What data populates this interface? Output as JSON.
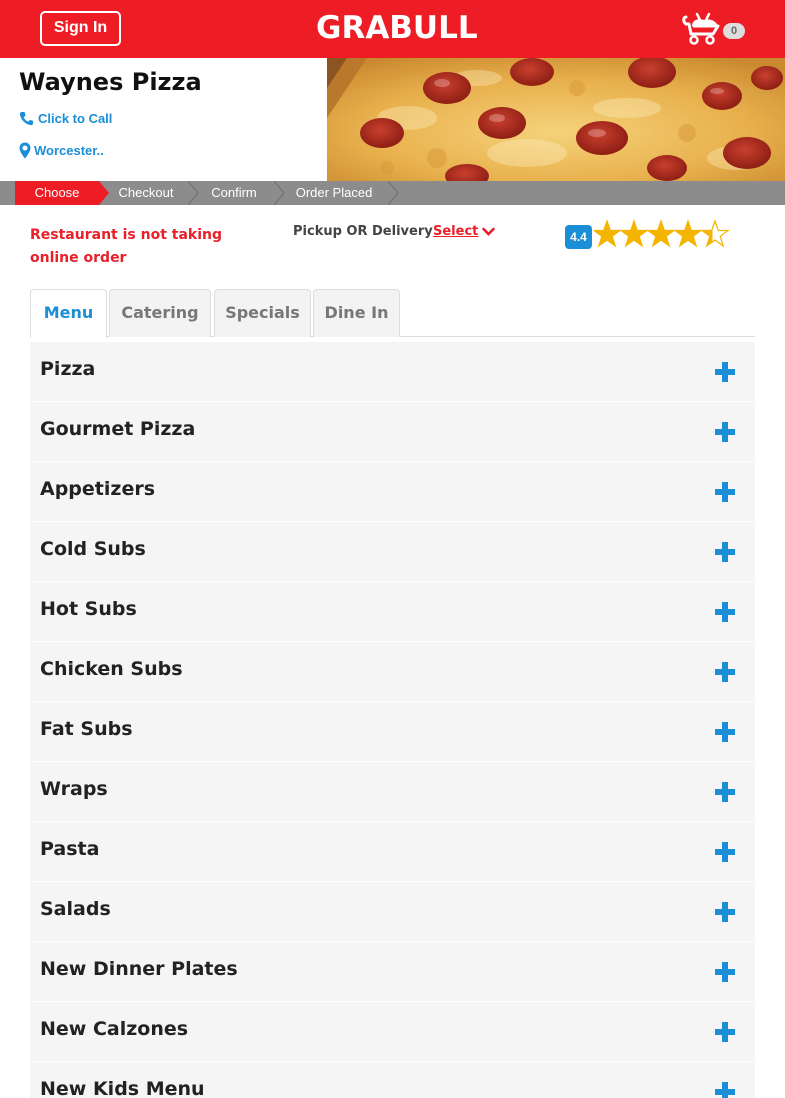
{
  "header": {
    "signin_label": "Sign In",
    "logo_text": "GRABULL",
    "cart_count": "0"
  },
  "restaurant": {
    "name": "Waynes Pizza",
    "call_label": "Click to Call",
    "location_label": "Worcester.."
  },
  "steps": [
    "Choose",
    "Checkout",
    "Confirm",
    "Order Placed"
  ],
  "status": {
    "notice": "Restaurant is not taking online order",
    "pickup_label": "Pickup OR Delivery",
    "select_label": "Select",
    "rating": "4.4"
  },
  "tabs": [
    "Menu",
    "Catering",
    "Specials",
    "Dine In"
  ],
  "menu_categories": [
    "Pizza",
    "Gourmet Pizza",
    "Appetizers",
    "Cold Subs",
    "Hot Subs",
    "Chicken Subs",
    "Fat Subs",
    "Wraps",
    "Pasta",
    "Salads",
    "New Dinner Plates",
    "New Calzones",
    "New Kids Menu"
  ],
  "colors": {
    "brand_red": "#ee1c24",
    "accent_blue": "#1a8fd6",
    "star_gold": "#f4b400"
  }
}
